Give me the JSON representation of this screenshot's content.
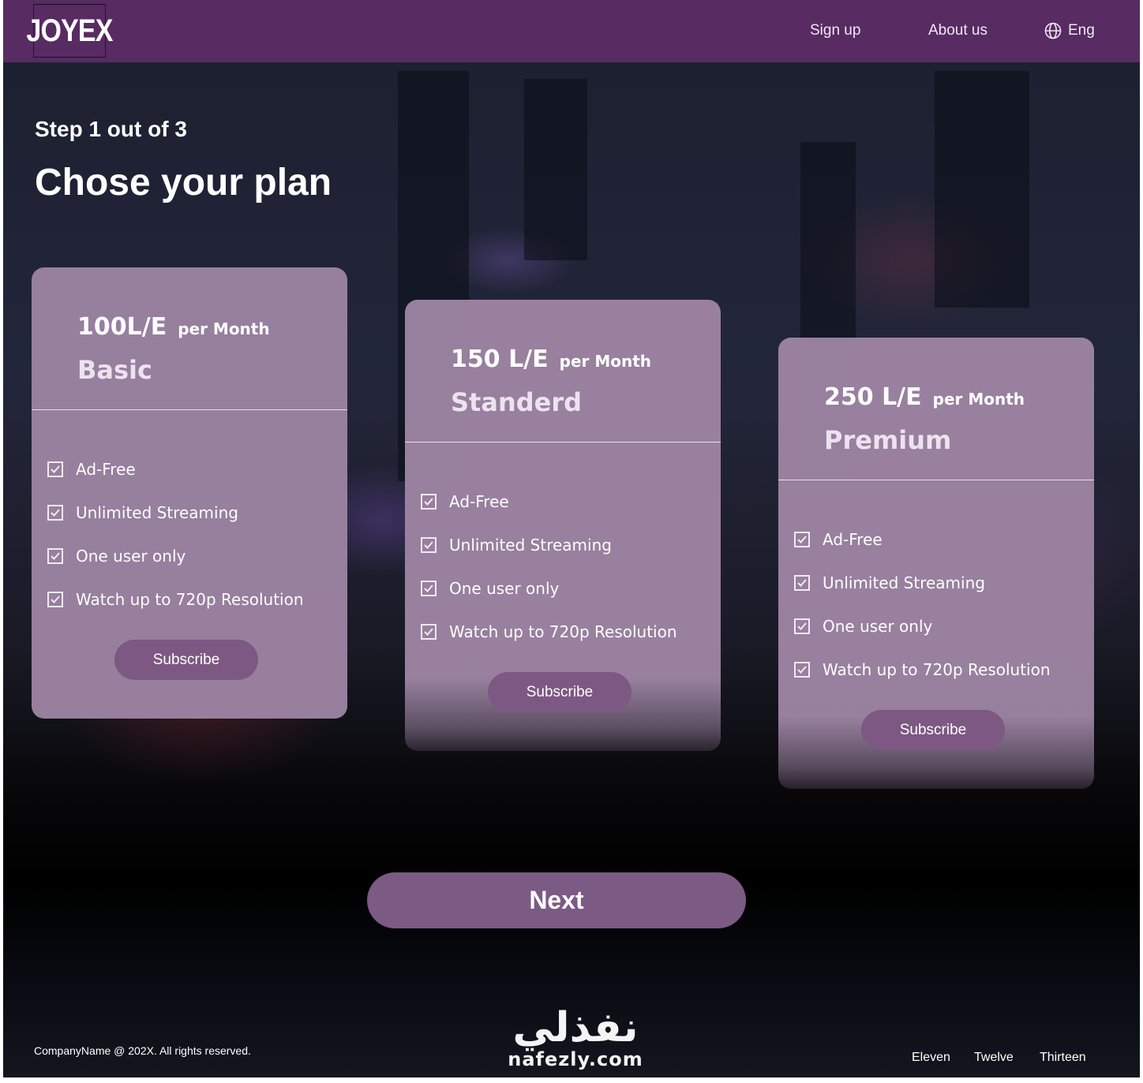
{
  "header": {
    "logo": "JOYEX",
    "nav": {
      "signup": "Sign up",
      "about": "About us",
      "language": "Eng"
    }
  },
  "main": {
    "step": "Step 1 out of 3",
    "title": "Chose your plan"
  },
  "plans": [
    {
      "price": "100L/E",
      "period": "per Month",
      "name": "Basic",
      "features": [
        "Ad-Free",
        "Unlimited Streaming",
        "One user only",
        "Watch up to 720p Resolution"
      ],
      "button": "Subscribe"
    },
    {
      "price": "150 L/E",
      "period": "per Month",
      "name": "Standerd",
      "features": [
        "Ad-Free",
        "Unlimited Streaming",
        "One user only",
        "Watch up to 720p Resolution"
      ],
      "button": "Subscribe"
    },
    {
      "price": "250 L/E",
      "period": "per Month",
      "name": "Premium",
      "features": [
        "Ad-Free",
        "Unlimited Streaming",
        "One user only",
        "Watch up to 720p Resolution"
      ],
      "button": "Subscribe"
    }
  ],
  "next_label": "Next",
  "footer": {
    "copyright": "CompanyName @ 202X. All rights reserved.",
    "links": [
      "Eleven",
      "Twelve",
      "Thirteen"
    ]
  },
  "watermark": {
    "arabic": "نفذلي",
    "latin": "nafezly.com"
  },
  "colors": {
    "header_bg": "#582b63",
    "card_bg": "#9a82a0",
    "button_bg": "#7d5882",
    "next_bg": "#7b5a84"
  },
  "icons": {
    "language": "globe-icon",
    "feature": "checkbox-checked-icon"
  }
}
